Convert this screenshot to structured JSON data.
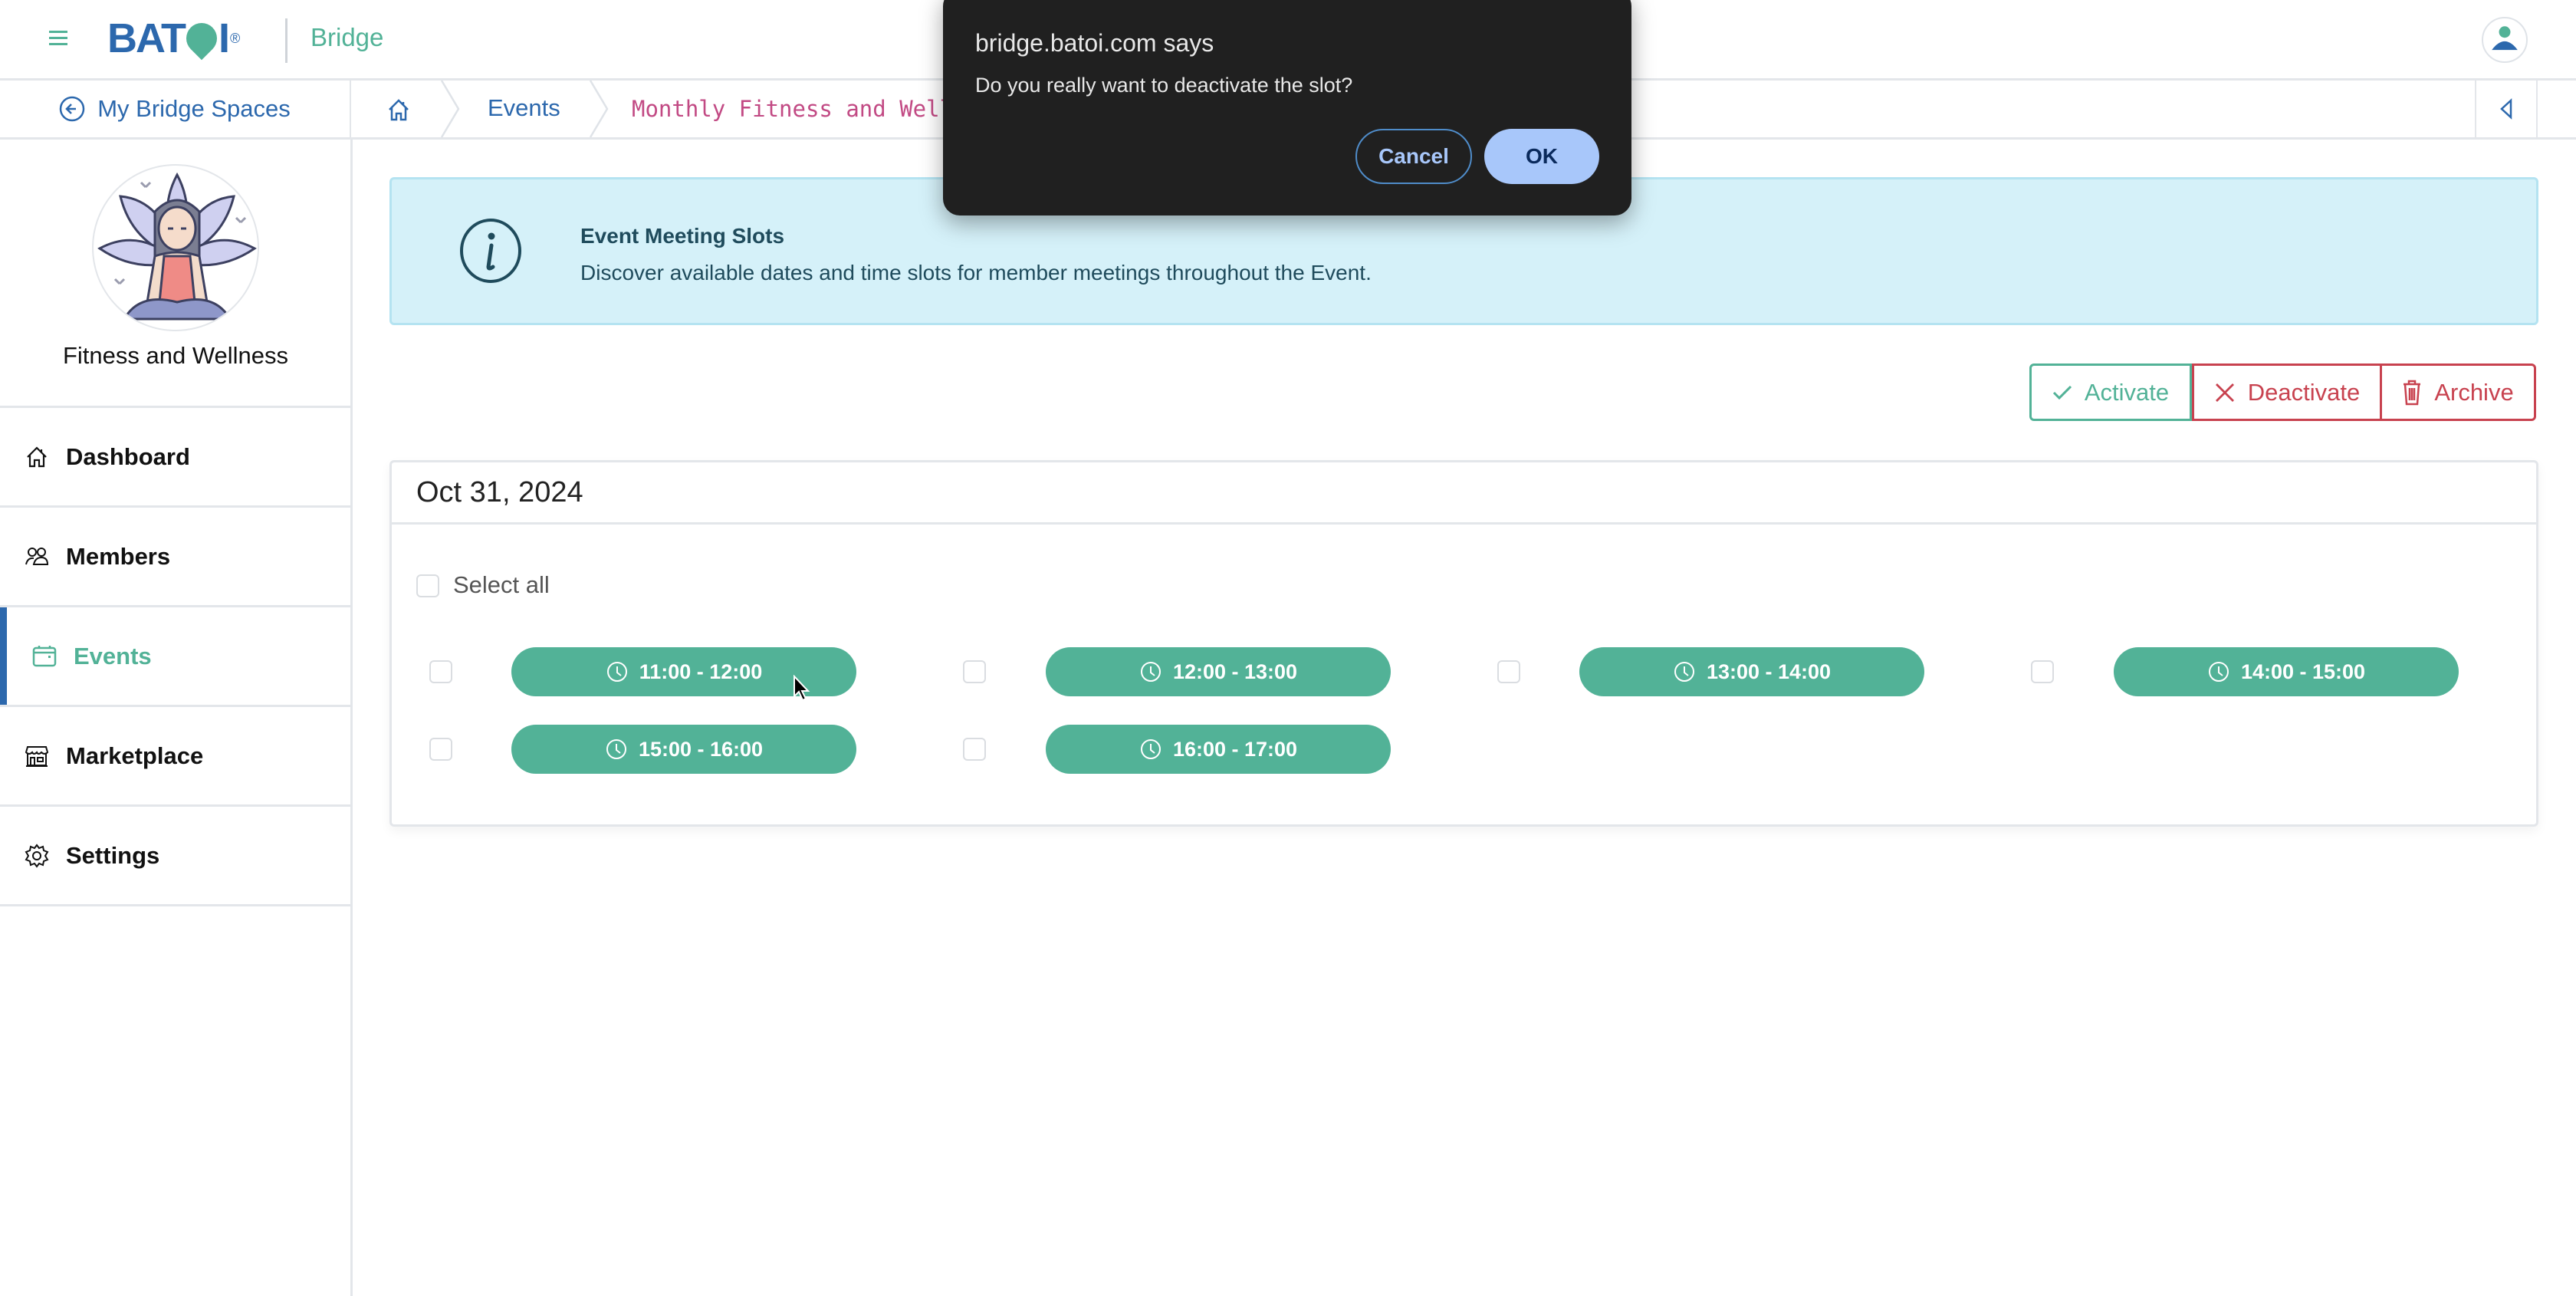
{
  "header": {
    "logo_text": "BAT",
    "logo_text_end": "I",
    "logo_reg": "®",
    "app_name": "Bridge",
    "menu_icon": "hamburger-icon",
    "user_icon": "user-avatar-icon"
  },
  "breadcrumb": {
    "back_label": "My Bridge Spaces",
    "home_icon": "home-icon",
    "events_label": "Events",
    "current_label": "Monthly Fitness and Well",
    "collapse_icon": "triangle-left-icon"
  },
  "sidebar": {
    "space_name": "Fitness and Wellness",
    "items": [
      {
        "label": "Dashboard",
        "icon": "home-icon",
        "active": false
      },
      {
        "label": "Members",
        "icon": "users-icon",
        "active": false
      },
      {
        "label": "Events",
        "icon": "calendar-icon",
        "active": true
      },
      {
        "label": "Marketplace",
        "icon": "store-icon",
        "active": false
      },
      {
        "label": "Settings",
        "icon": "gear-icon",
        "active": false
      }
    ]
  },
  "info": {
    "title": "Event Meeting Slots",
    "text": "Discover available dates and time slots for member meetings throughout the Event."
  },
  "actions": {
    "activate": "Activate",
    "deactivate": "Deactivate",
    "archive": "Archive"
  },
  "card": {
    "date": "Oct 31, 2024",
    "select_all": "Select all",
    "slots": [
      {
        "label": "11:00 - 12:00",
        "checked": false
      },
      {
        "label": "12:00 - 13:00",
        "checked": false
      },
      {
        "label": "13:00 - 14:00",
        "checked": false
      },
      {
        "label": "14:00 - 15:00",
        "checked": false
      },
      {
        "label": "15:00 - 16:00",
        "checked": false
      },
      {
        "label": "16:00 - 17:00",
        "checked": false
      }
    ]
  },
  "dialog": {
    "title": "bridge.batoi.com says",
    "message": "Do you really want to deactivate the slot?",
    "cancel": "Cancel",
    "ok": "OK"
  },
  "colors": {
    "brand_blue": "#2c68ad",
    "brand_green": "#52b297",
    "danger": "#c8424f",
    "breadcrumb_current": "#c24a84",
    "info_bg": "#d5f1f9",
    "dialog_bg": "#202020",
    "dialog_ok_bg": "#a8c7fa"
  }
}
